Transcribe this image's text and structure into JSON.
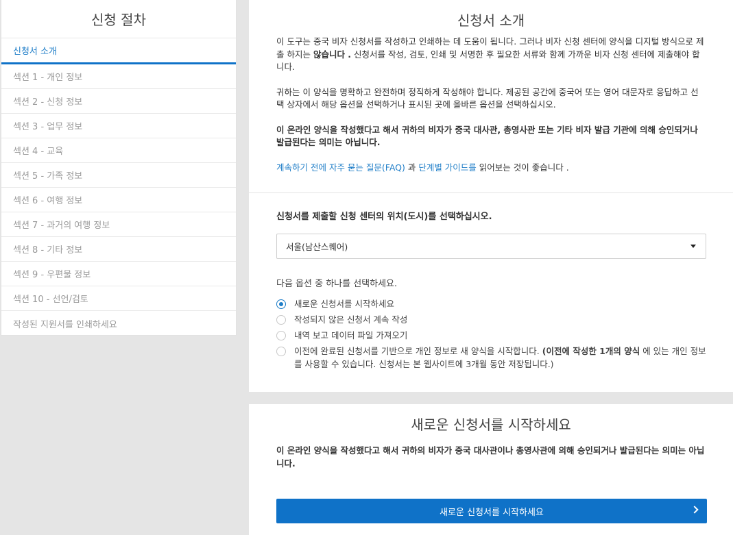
{
  "sidebar": {
    "title": "신청 절차",
    "items": [
      {
        "label": "신청서 소개"
      },
      {
        "label": "섹션 1 - 개인 정보"
      },
      {
        "label": "섹션 2 - 신청 정보"
      },
      {
        "label": "섹션 3 - 업무 정보"
      },
      {
        "label": "섹션 4 - 교육"
      },
      {
        "label": "섹션 5 - 가족 정보"
      },
      {
        "label": "섹션 6 - 여행 정보"
      },
      {
        "label": "섹션 7 - 과거의 여행 정보"
      },
      {
        "label": "섹션 8 - 기타 정보"
      },
      {
        "label": "섹션 9 - 우편물 정보"
      },
      {
        "label": "섹션 10 - 선언/검토"
      },
      {
        "label": "작성된 지원서를 인쇄하세요"
      }
    ]
  },
  "intro": {
    "title": "신청서 소개",
    "p1_a": "이 도구는 중국 비자 신청서를 작성하고 인쇄하는 데 도움이 됩니다. 그러나 비자 신청 센터에 양식을 디지털 방식으로 제출 하지는 ",
    "p1_b": "않습니다 .",
    "p1_c": " 신청서를 작성, 검토, 인쇄 및 서명한 후 필요한 서류와 함께 가까운 비자 신청 센터에 제출해야 합니다.",
    "p2": "귀하는 이 양식을 명확하고 완전하며 정직하게 작성해야 합니다. 제공된 공간에 중국어 또는 영어 대문자로 응답하고 선택 상자에서 해당 옵션을 선택하거나 표시된 곳에 올바른 옵션을 선택하십시오.",
    "p3": "이 온라인 양식을 작성했다고 해서 귀하의 비자가 중국 대사관, 총영사관 또는 기타 비자 발급 기관에 의해 승인되거나 발급된다는 의미는 아닙니다.",
    "faq_link": "계속하기 전에 자주 묻는 질문(FAQ)",
    "faq_mid": " 과 ",
    "guide_link": "단계별 가이드를",
    "faq_end": " 읽어보는 것이 좋습니다 ."
  },
  "location": {
    "label": "신청서를 제출할 신청 센터의 위치(도시)를 선택하십시오.",
    "selected": "서울(남산스퀘어)"
  },
  "options": {
    "label": "다음 옵션 중 하나를 선택하세요.",
    "items": [
      {
        "text": "새로운 신청서를 시작하세요",
        "checked": true
      },
      {
        "text": "작성되지 않은 신청서 계속 작성",
        "checked": false
      },
      {
        "text": "내역 보고 데이터 파일 가져오기",
        "checked": false
      }
    ],
    "last_a": "이전에 완료된 신청서를 기반으로 개인 정보로 새 양식을 시작합니다. ",
    "last_b": "(이전에 작성한 1개의 양식",
    "last_c": " 에 있는 개인 정보를 사용할 수 있습니다. 신청서는 본 웹사이트에 3개월 동안 저장됩니다.)"
  },
  "start": {
    "title": "새로운 신청서를 시작하세요",
    "note": "이 온라인 양식을 작성했다고 해서 귀하의 비자가 중국 대사관이나 총영사관에 의해 승인되거나 발급된다는 의미는 아닙니다.",
    "button": "새로운 신청서를 시작하세요"
  },
  "colors": {
    "accent": "#0f72c8",
    "link": "#1f7ec8",
    "background": "#e5e5e5"
  }
}
